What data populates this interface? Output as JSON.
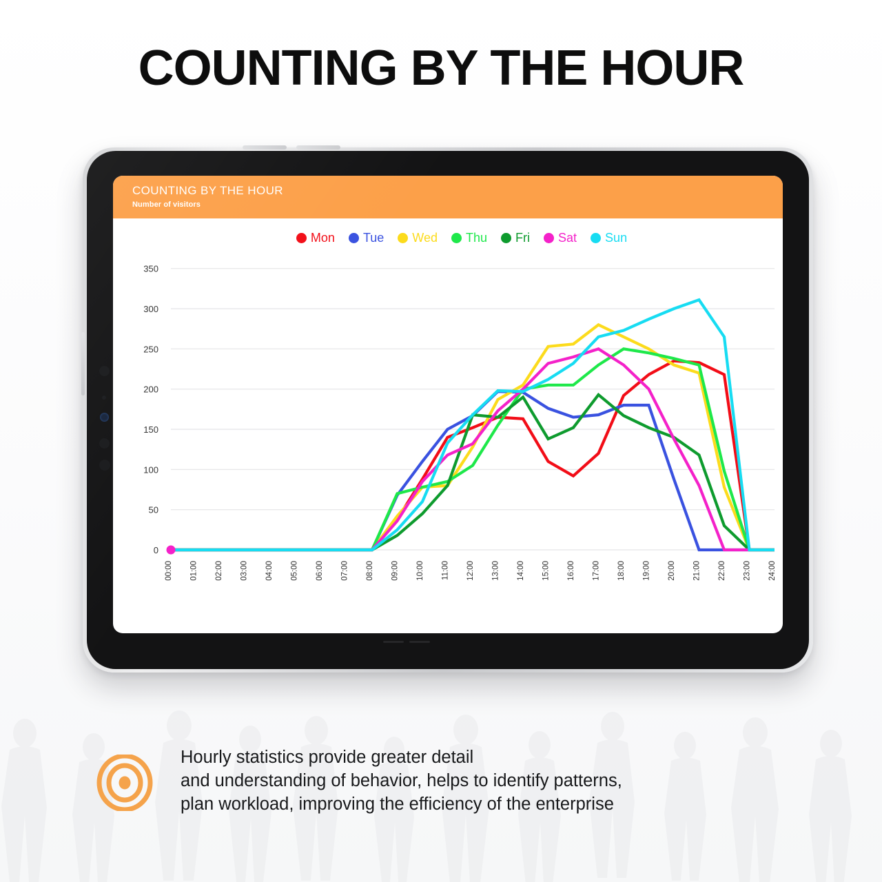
{
  "main_title": "COUNTING BY THE HOUR",
  "card": {
    "title": "COUNTING BY THE HOUR",
    "subtitle": "Number of visitors"
  },
  "caption": "Hourly statistics provide greater detail\nand understanding of behavior, helps to identify patterns,\nplan workload, improving the efficiency of the enterprise",
  "colors": {
    "accent_orange": "#FCA049",
    "mon": "#F20D17",
    "tue": "#3A52E0",
    "wed": "#FCDB1C",
    "thu": "#1EE84A",
    "fri": "#0E9B2E",
    "sat": "#F421C9",
    "sun": "#17DCF2",
    "grid": "#E4E4E6",
    "device_body": "#131314"
  },
  "legend": [
    {
      "label": "Mon",
      "color": "#F20D17"
    },
    {
      "label": "Tue",
      "color": "#3A52E0"
    },
    {
      "label": "Wed",
      "color": "#FCDB1C"
    },
    {
      "label": "Thu",
      "color": "#1EE84A"
    },
    {
      "label": "Fri",
      "color": "#0E9B2E"
    },
    {
      "label": "Sat",
      "color": "#F421C9"
    },
    {
      "label": "Sun",
      "color": "#17DCF2"
    }
  ],
  "chart_data": {
    "type": "line",
    "title": "COUNTING BY THE HOUR",
    "subtitle": "Number of visitors",
    "xlabel": "",
    "ylabel": "Number of visitors",
    "ylim": [
      0,
      360
    ],
    "yticks": [
      0,
      50,
      100,
      150,
      200,
      250,
      300,
      350
    ],
    "grid": true,
    "legend_position": "top-center",
    "categories": [
      "00:00",
      "01:00",
      "02:00",
      "03:00",
      "04:00",
      "05:00",
      "06:00",
      "07:00",
      "08:00",
      "09:00",
      "10:00",
      "11:00",
      "12:00",
      "13:00",
      "14:00",
      "15:00",
      "16:00",
      "17:00",
      "18:00",
      "19:00",
      "20:00",
      "21:00",
      "22:00",
      "23:00",
      "24:00"
    ],
    "series": [
      {
        "name": "Mon",
        "color": "#F20D17",
        "values": [
          0,
          0,
          0,
          0,
          0,
          0,
          0,
          0,
          0,
          38,
          88,
          140,
          152,
          165,
          163,
          110,
          92,
          120,
          192,
          218,
          235,
          233,
          218,
          0,
          0
        ]
      },
      {
        "name": "Tue",
        "color": "#3A52E0",
        "values": [
          0,
          0,
          0,
          0,
          0,
          0,
          0,
          0,
          0,
          68,
          110,
          150,
          167,
          197,
          196,
          176,
          165,
          168,
          180,
          180,
          88,
          0,
          0,
          0,
          0
        ]
      },
      {
        "name": "Wed",
        "color": "#FCDB1C",
        "values": [
          0,
          0,
          0,
          0,
          0,
          0,
          0,
          0,
          0,
          42,
          78,
          80,
          128,
          187,
          205,
          253,
          256,
          280,
          265,
          250,
          230,
          220,
          78,
          0,
          0
        ]
      },
      {
        "name": "Thu",
        "color": "#1EE84A",
        "values": [
          0,
          0,
          0,
          0,
          0,
          0,
          0,
          0,
          0,
          70,
          78,
          85,
          105,
          155,
          200,
          205,
          205,
          230,
          250,
          245,
          238,
          230,
          98,
          0,
          0
        ]
      },
      {
        "name": "Fri",
        "color": "#0E9B2E",
        "values": [
          0,
          0,
          0,
          0,
          0,
          0,
          0,
          0,
          0,
          18,
          45,
          80,
          168,
          165,
          190,
          138,
          152,
          193,
          167,
          152,
          140,
          118,
          30,
          0,
          0
        ]
      },
      {
        "name": "Sat",
        "color": "#F421C9",
        "values": [
          0,
          0,
          0,
          0,
          0,
          0,
          0,
          0,
          0,
          36,
          85,
          118,
          132,
          173,
          200,
          232,
          240,
          250,
          230,
          200,
          138,
          80,
          0,
          0,
          0
        ]
      },
      {
        "name": "Sun",
        "color": "#17DCF2",
        "values": [
          0,
          0,
          0,
          0,
          0,
          0,
          0,
          0,
          0,
          25,
          60,
          133,
          168,
          198,
          197,
          212,
          232,
          265,
          273,
          287,
          300,
          311,
          265,
          0,
          0
        ]
      }
    ],
    "flat_baseline_note": "All series are 0 from 00:00 through 08:00 and from 23:00 to 24:00"
  }
}
